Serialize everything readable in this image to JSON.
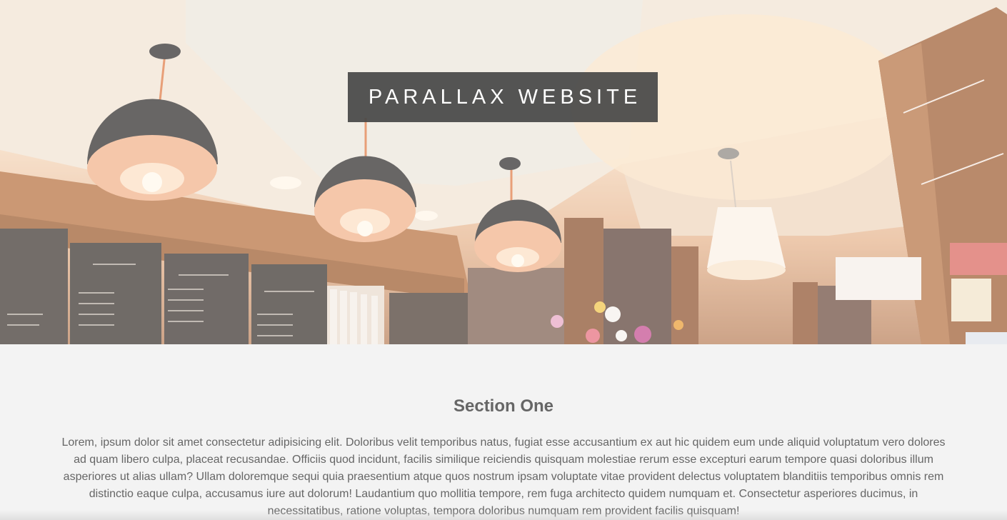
{
  "hero": {
    "title": "PARALLAX WEBSITE",
    "image_description_icon": "cafe-interior-photo"
  },
  "section_one": {
    "heading": "Section One",
    "body": "Lorem, ipsum dolor sit amet consectetur adipisicing elit. Doloribus velit temporibus natus, fugiat esse accusantium ex aut hic quidem eum unde aliquid voluptatum vero dolores ad quam libero culpa, placeat recusandae. Officiis quod incidunt, facilis similique reiciendis quisquam molestiae rerum esse excepturi earum tempore quasi doloribus illum asperiores ut alias ullam? Ullam doloremque sequi quia praesentium atque quos nostrum ipsam voluptate vitae provident delectus voluptatem blanditiis temporibus omnis rem distinctio eaque culpa, accusamus iure aut dolorum! Laudantium quo mollitia tempore, rem fuga architecto quidem numquam et. Consectetur asperiores ducimus, in necessitatibus, ratione voluptas, tempora doloribus numquam rem provident facilis quisquam!"
  },
  "colors": {
    "page_background": "#f3f3f3",
    "title_box": "#464646",
    "text": "#666666"
  }
}
